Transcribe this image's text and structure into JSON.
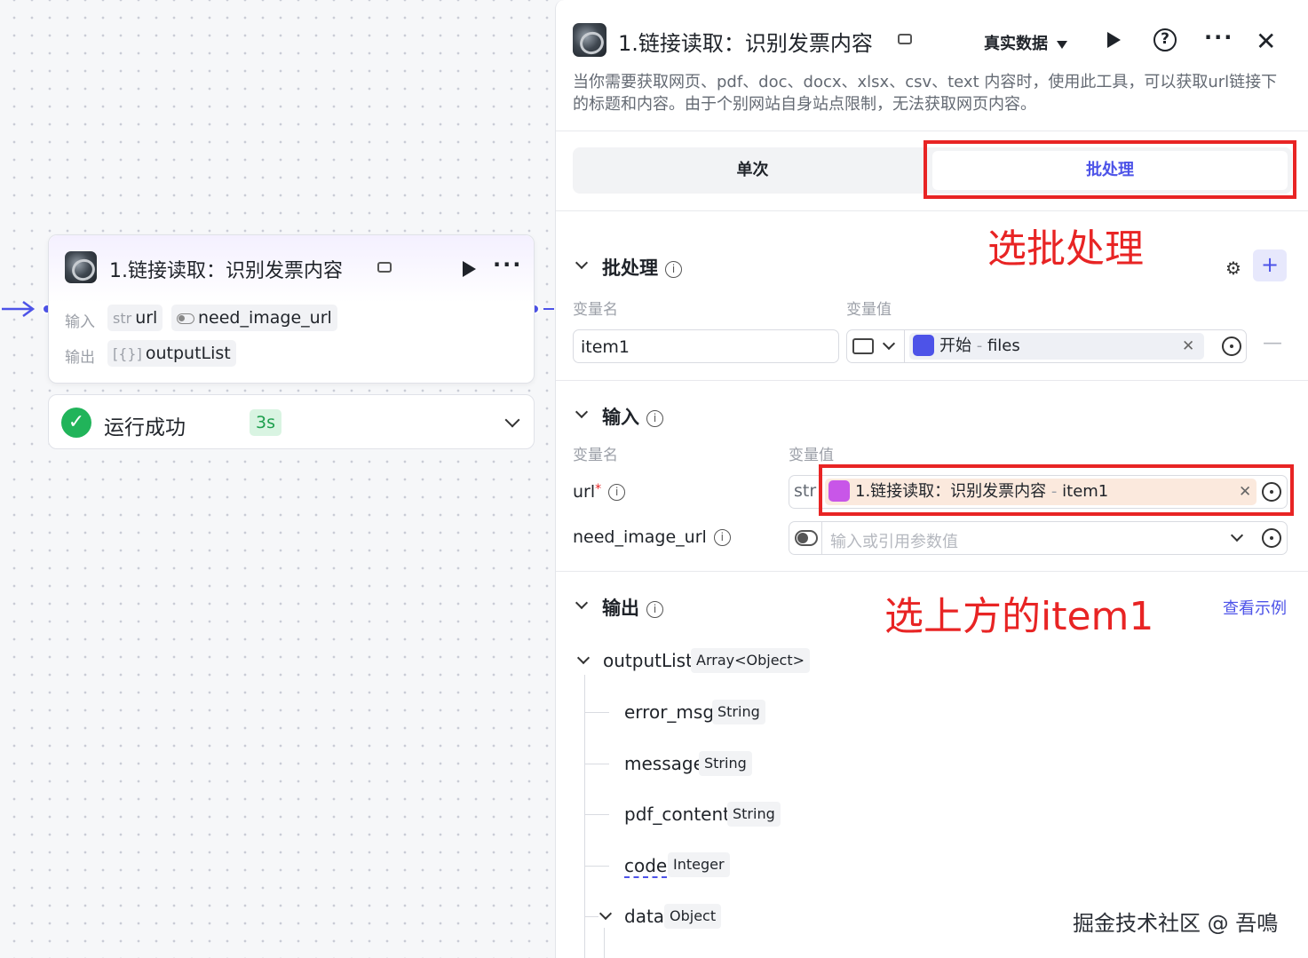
{
  "canvas": {
    "node": {
      "title": "1.链接读取：识别发票内容",
      "input_label": "输入",
      "output_label": "输出",
      "inputs": [
        {
          "prefix": "str",
          "name": "url"
        },
        {
          "prefix": "toggle",
          "name": "need_image_url"
        }
      ],
      "output": {
        "prefix": "[{}]",
        "name": "outputList"
      }
    },
    "status": {
      "text": "运行成功",
      "duration": "3s"
    }
  },
  "panel": {
    "title": "1.链接读取：识别发票内容",
    "data_mode": "真实数据",
    "description": "当你需要获取网页、pdf、doc、docx、xlsx、csv、text 内容时，使用此工具，可以获取url链接下的标题和内容。由于个别网站自身站点限制，无法获取网页内容。",
    "tabs": {
      "single": "单次",
      "batch": "批处理",
      "active": "batch"
    },
    "batch": {
      "heading": "批处理",
      "col_name": "变量名",
      "col_value": "变量值",
      "item_name": "item1",
      "ref_source": "开始",
      "ref_sep": " - ",
      "ref_field": "files"
    },
    "inputs": {
      "heading": "输入",
      "col_name": "变量名",
      "col_value": "变量值",
      "url_name": "url",
      "url_required": "*",
      "url_type": "str",
      "url_ref_source": "1.链接读取：识别发票内容",
      "url_ref_sep": " - ",
      "url_ref_field": "item1",
      "need_image_name": "need_image_url",
      "need_image_placeholder": "输入或引用参数值"
    },
    "outputs": {
      "heading": "输出",
      "view_example": "查看示例",
      "root": {
        "name": "outputList",
        "type": "Array<Object>"
      },
      "children": [
        {
          "name": "error_msg",
          "type": "String"
        },
        {
          "name": "message",
          "type": "String"
        },
        {
          "name": "pdf_content",
          "type": "String"
        },
        {
          "name": "code",
          "type": "Integer"
        },
        {
          "name": "data",
          "type": "Object"
        }
      ]
    }
  },
  "annotations": {
    "batch_hint": "选批处理",
    "item_hint": "选上方的item1"
  },
  "watermark": "掘金技术社区 @ 吾鳴",
  "colors": {
    "accent": "#4d53e8",
    "annotation_red": "#e82424",
    "success": "#21b45a"
  }
}
